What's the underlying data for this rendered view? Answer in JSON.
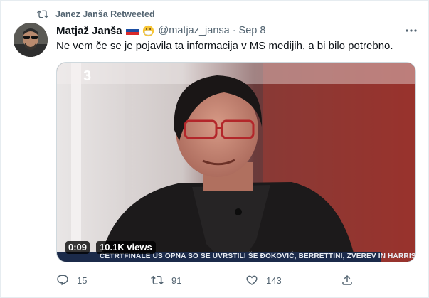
{
  "retweet": {
    "label": "Janez Janša Retweeted",
    "icon": "retweet-icon"
  },
  "tweet": {
    "author_name": "Matjaž Janša",
    "handle": "@matjaz_jansa",
    "separator": "·",
    "date": "Sep 8",
    "text": "Ne vem če se je pojavila ta informacija v MS medijih, a bi bilo potrebno.",
    "badges": [
      "slovenia-flag-icon",
      "face-with-mask-emoji"
    ]
  },
  "media": {
    "timestamp": "0:09",
    "views": "10.1K views",
    "ticker_text": "ČETRTFINALE US OPNA SO SE UVRSTILI ŠE ĐOKOVIĆ, BERRETTINI, ZVEREV IN HARRIS",
    "channel_logo": "3"
  },
  "actions": {
    "reply_count": "15",
    "retweet_count": "91",
    "like_count": "143"
  },
  "colors": {
    "secondary_text": "#536471",
    "primary_text": "#0f1419",
    "border": "#e6ecf0"
  }
}
